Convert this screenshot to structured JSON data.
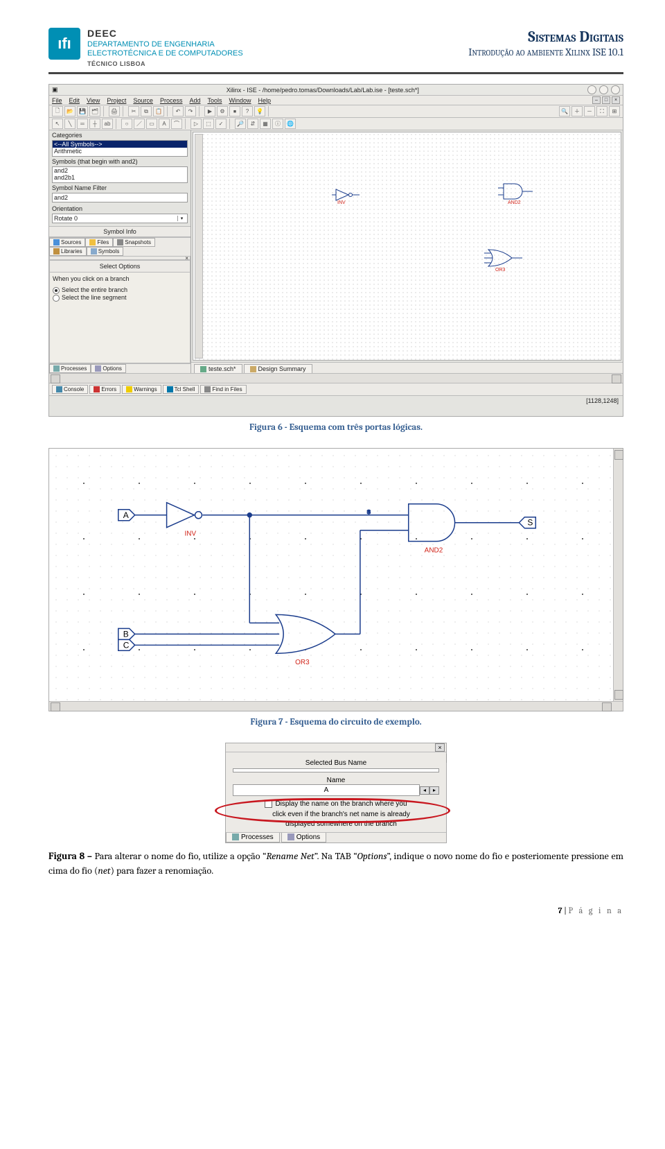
{
  "header": {
    "dept_code": "DEEC",
    "dept_line1": "DEPARTAMENTO DE ENGENHARIA",
    "dept_line2": "ELECTROTÉCNICA E DE COMPUTADORES",
    "dept_line3": "TÉCNICO LISBOA",
    "title_main": "Sistemas Digitais",
    "title_sub": "Introdução ao ambiente Xilinx ISE 10.1",
    "logo_text": "ıfı"
  },
  "ise": {
    "window_title": "Xilinx - ISE - /home/pedro.tomas/Downloads/Lab/Lab.ise - [teste.sch*]",
    "menu": [
      "File",
      "Edit",
      "View",
      "Project",
      "Source",
      "Process",
      "Add",
      "Tools",
      "Window",
      "Help"
    ],
    "panel": {
      "categories_label": "Categories",
      "categories_items": [
        "<--All Symbols-->",
        "Arithmetic"
      ],
      "symbols_label": "Symbols (that begin with and2)",
      "symbols_items": [
        "and2",
        "and2b1"
      ],
      "filter_label": "Symbol Name Filter",
      "filter_value": "and2",
      "orientation_label": "Orientation",
      "orientation_value": "Rotate 0",
      "symbol_info": "Symbol Info"
    },
    "left_tabs": [
      "Sources",
      "Files",
      "Snapshots",
      "Libraries",
      "Symbols"
    ],
    "select_options": {
      "header": "Select Options",
      "prompt": "When you click on a branch",
      "opt1": "Select the entire branch",
      "opt2": "Select the line segment"
    },
    "process_tabs": [
      "Processes",
      "Options"
    ],
    "schem_tabs": [
      "teste.sch*",
      "Design Summary"
    ],
    "bottom_tabs": [
      "Console",
      "Errors",
      "Warnings",
      "Tcl Shell",
      "Find in Files"
    ],
    "status": "[1128,1248]",
    "mini_gates": {
      "inv_label": "INV",
      "and_label": "AND2",
      "or_label": "OR3"
    }
  },
  "caption6": "Figura 6 - Esquema com três portas lógicas.",
  "circuit": {
    "port_A": "A",
    "port_B": "B",
    "port_C": "C",
    "port_S": "S",
    "gate_inv": "INV",
    "gate_and": "AND2",
    "gate_or": "OR3"
  },
  "caption7": "Figura 7 - Esquema do circuito de exemplo.",
  "opt": {
    "selbus_label": "Selected Bus Name",
    "selbus_value": "",
    "name_label": "Name",
    "name_value": "A",
    "cb_text1": "Display the name on the branch where you",
    "cb_text2": "click even if the branch's net name is already",
    "cb_text3": "displayed somewhere on the branch",
    "tab_processes": "Processes",
    "tab_options": "Options"
  },
  "body8": {
    "prefix": "Figura 8 – ",
    "t1": "Para alterar o nome do fio, utilize a opção “",
    "em1": "Rename Net",
    "t2": "”. Na TAB “",
    "em2": "Options",
    "t3": "”, indique o novo nome do fio e posteriomente pressione em cima do fio (",
    "em3": "net",
    "t4": ") para fazer a renomiação."
  },
  "footer": {
    "num": "7",
    "sep": " | ",
    "word": "P á g i n a"
  }
}
